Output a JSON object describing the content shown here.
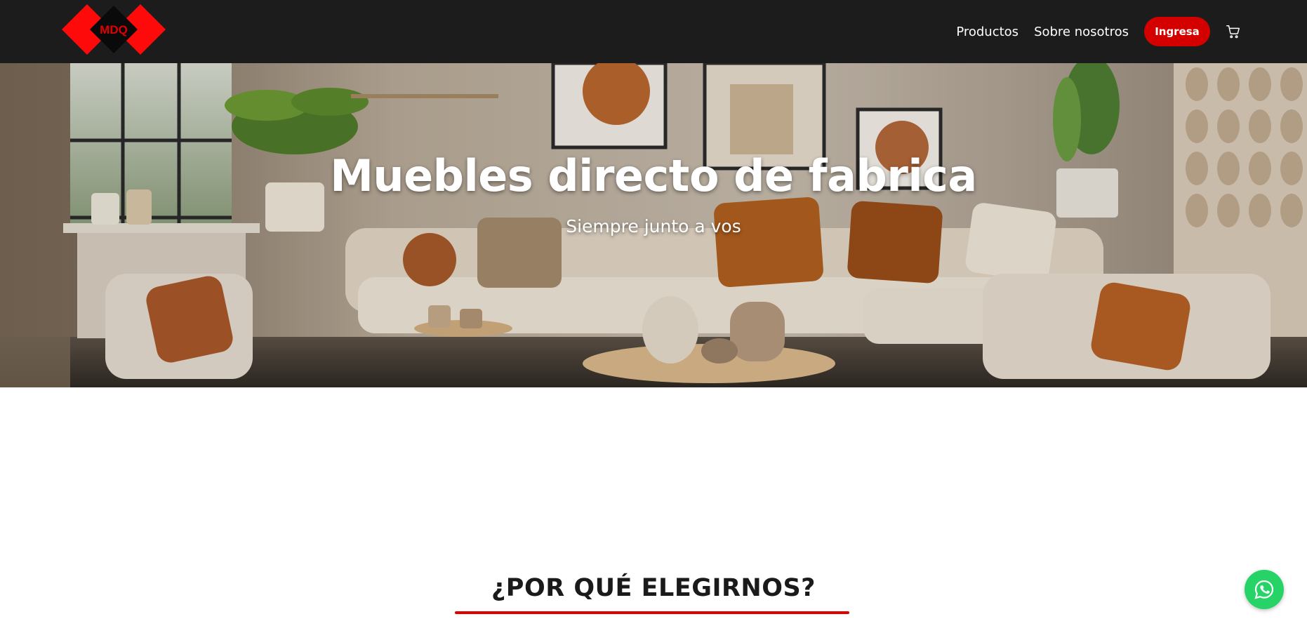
{
  "brand": {
    "logo_text": "MDQ",
    "logo_color": "#ff0000"
  },
  "nav": {
    "items": [
      {
        "label": "Productos"
      },
      {
        "label": "Sobre nosotros"
      }
    ],
    "login_label": "Ingresa",
    "cart_icon": "cart-icon"
  },
  "hero": {
    "title": "Muebles directo de fabrica",
    "subtitle": "Siempre junto a vos"
  },
  "section": {
    "title": "¿POR QUÉ ELEGIRNOS?",
    "accent_color": "#e00000"
  },
  "floating": {
    "whatsapp_icon": "whatsapp-icon",
    "color": "#25d366"
  }
}
